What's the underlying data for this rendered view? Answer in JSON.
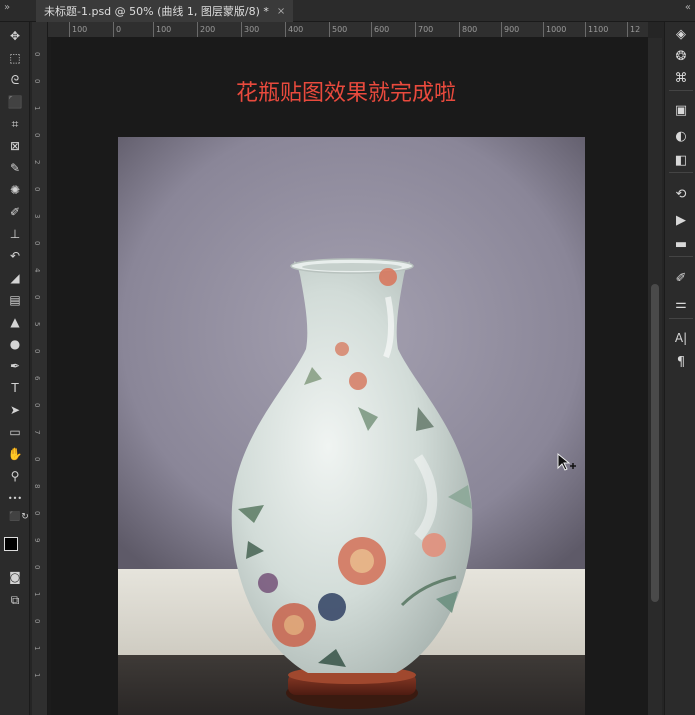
{
  "tab": {
    "title": "未标题-1.psd @ 50% (曲线 1, 图层蒙版/8) *",
    "close_glyph": "×"
  },
  "collapse": {
    "left": "»",
    "right": "«"
  },
  "ruler_top": [
    "100",
    "0",
    "100",
    "200",
    "300",
    "400",
    "500",
    "600",
    "700",
    "800",
    "900",
    "1000",
    "1100",
    "12"
  ],
  "ruler_left": [
    "0",
    "0",
    "1",
    "0",
    "2",
    "0",
    "3",
    "0",
    "4",
    "0",
    "5",
    "0",
    "6",
    "0",
    "7",
    "0",
    "8",
    "0",
    "9",
    "0",
    "1",
    "0",
    "1",
    "1"
  ],
  "headline": "花瓶贴图效果就完成啦",
  "tools": [
    {
      "name": "move-tool-icon",
      "glyph": "✥"
    },
    {
      "name": "marquee-tool-icon",
      "glyph": "⬚"
    },
    {
      "name": "lasso-tool-icon",
      "glyph": "ᘓ"
    },
    {
      "name": "quick-select-tool-icon",
      "glyph": "⬛"
    },
    {
      "name": "crop-tool-icon",
      "glyph": "⌗"
    },
    {
      "name": "frame-tool-icon",
      "glyph": "⊠"
    },
    {
      "name": "eyedropper-tool-icon",
      "glyph": "✎"
    },
    {
      "name": "healing-brush-tool-icon",
      "glyph": "✺"
    },
    {
      "name": "brush-tool-icon",
      "glyph": "✐"
    },
    {
      "name": "stamp-tool-icon",
      "glyph": "⊥"
    },
    {
      "name": "history-brush-tool-icon",
      "glyph": "↶"
    },
    {
      "name": "eraser-tool-icon",
      "glyph": "◢"
    },
    {
      "name": "gradient-tool-icon",
      "glyph": "▤"
    },
    {
      "name": "blur-tool-icon",
      "glyph": "▲"
    },
    {
      "name": "dodge-tool-icon",
      "glyph": "●"
    },
    {
      "name": "pen-tool-icon",
      "glyph": "✒"
    },
    {
      "name": "type-tool-icon",
      "glyph": "T"
    },
    {
      "name": "path-select-tool-icon",
      "glyph": "➤"
    },
    {
      "name": "rectangle-tool-icon",
      "glyph": "▭"
    },
    {
      "name": "hand-tool-icon",
      "glyph": "✋"
    },
    {
      "name": "zoom-tool-icon",
      "glyph": "⚲"
    },
    {
      "name": "more-tools-icon",
      "glyph": "•••"
    }
  ],
  "right_icons": [
    {
      "name": "layers-panel-icon",
      "glyph": "◈"
    },
    {
      "name": "channels-panel-icon",
      "glyph": "❂"
    },
    {
      "name": "paths-panel-icon",
      "glyph": "⌘"
    },
    {
      "name": "libraries-panel-icon",
      "glyph": "▣"
    },
    {
      "name": "adjustments-panel-icon",
      "glyph": "◐"
    },
    {
      "name": "properties-panel-icon",
      "glyph": "◧"
    },
    {
      "name": "history-panel-icon",
      "glyph": "⟲"
    },
    {
      "name": "actions-panel-icon",
      "glyph": "▶"
    },
    {
      "name": "comments-panel-icon",
      "glyph": "▬"
    },
    {
      "name": "brush-settings-panel-icon",
      "glyph": "✐"
    },
    {
      "name": "tool-presets-panel-icon",
      "glyph": "⚌"
    },
    {
      "name": "character-panel-icon",
      "glyph": "A|"
    },
    {
      "name": "paragraph-panel-icon",
      "glyph": "¶"
    }
  ],
  "colors": {
    "headline": "#e94a3d",
    "wall": "#8e8a9a",
    "floor": "#3a3634",
    "vase": "#d8e0dc"
  }
}
